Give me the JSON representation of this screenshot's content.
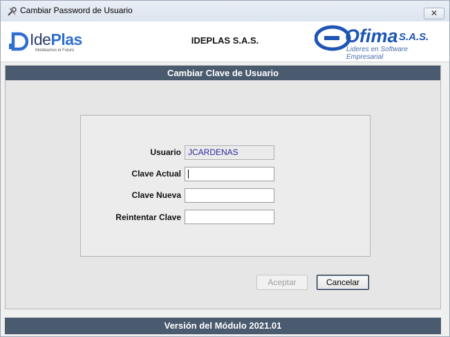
{
  "window": {
    "title": "Cambiar Password de Usuario",
    "close_label": "✕"
  },
  "header": {
    "company": "IDEPLAS S.A.S.",
    "ideplas_logo": {
      "ide": "Ide",
      "plas": "Plas",
      "tagline": "Moldeamos el Futuro"
    },
    "ofima_logo": {
      "word": "Ofima",
      "sas": "S.A.S.",
      "tagline": "Lideres en Software Empresarial"
    }
  },
  "form": {
    "heading": "Cambiar Clave de Usuario",
    "usuario_label": "Usuario",
    "usuario_value": "JCARDENAS",
    "clave_actual_label": "Clave Actual",
    "clave_actual_value": "",
    "clave_nueva_label": "Clave Nueva",
    "clave_nueva_value": "",
    "reintentar_label": "Reintentar Clave",
    "reintentar_value": ""
  },
  "buttons": {
    "aceptar": "Aceptar",
    "cancelar": "Cancelar"
  },
  "footer": {
    "version": "Versión del Módulo 2021.01"
  },
  "colors": {
    "bar": "#4a5a6f",
    "brand_blue": "#1d55b4"
  },
  "icons": {
    "app": "tools-icon",
    "close": "close-icon"
  }
}
